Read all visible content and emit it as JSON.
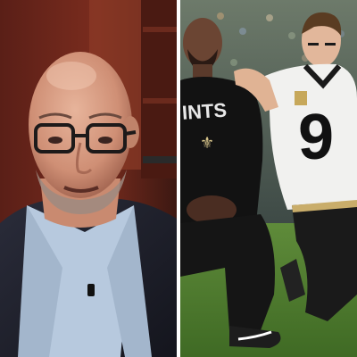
{
  "collage": {
    "left_panel": {
      "subject": "man-speaking-in-studio"
    },
    "right_panel": {
      "subject": "two-football-players-kneeling",
      "jersey_text_left": "INTS",
      "jersey_number_right": "9"
    }
  }
}
